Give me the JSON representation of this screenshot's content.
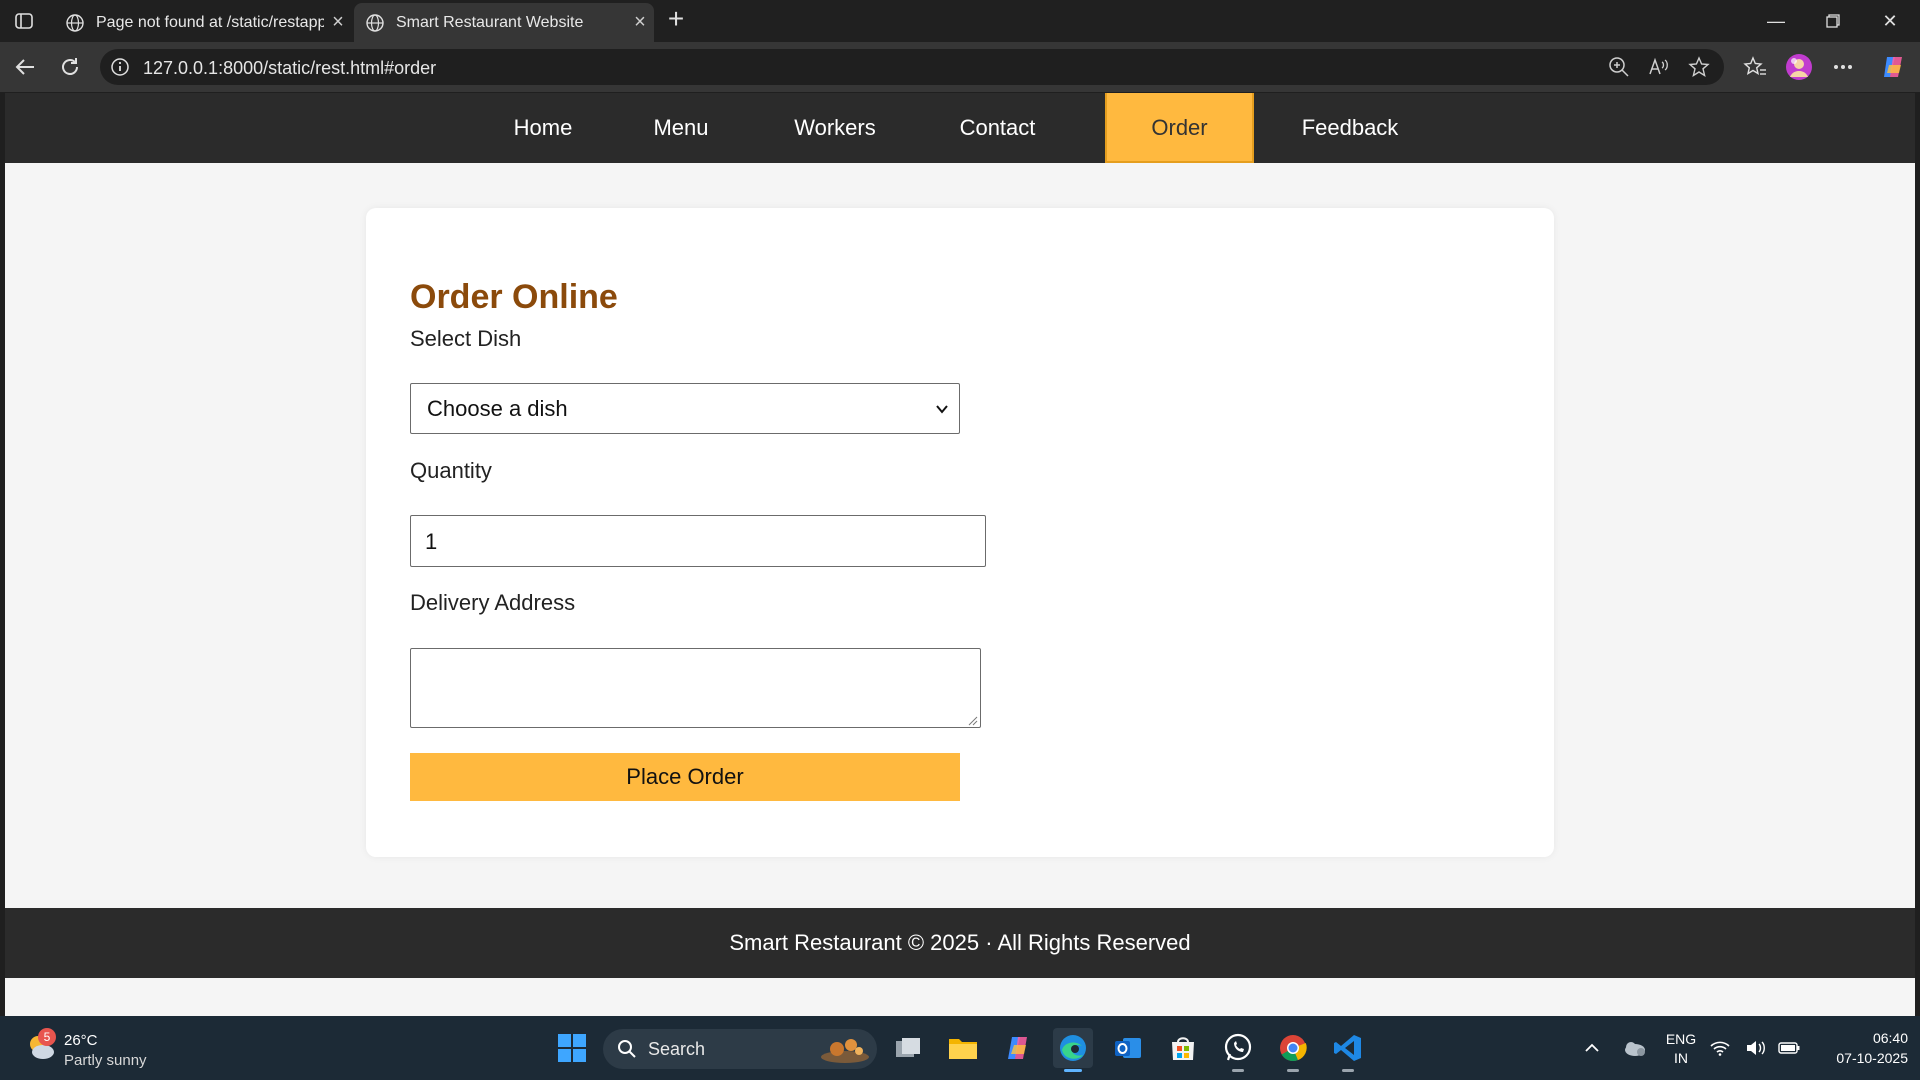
{
  "browser": {
    "tabs": [
      {
        "title": "Page not found at /static/restapp",
        "active": false
      },
      {
        "title": "Smart Restaurant Website",
        "active": true
      }
    ],
    "url": "127.0.0.1:8000/static/rest.html#order"
  },
  "site": {
    "nav": [
      "Home",
      "Menu",
      "Workers",
      "Contact",
      "Order",
      "Feedback"
    ],
    "active_nav": "Order",
    "accent_color": "#ffb93f",
    "heading_color": "#8b4a0b",
    "order": {
      "title": "Order Online",
      "dish_label": "Select Dish",
      "dish_selected": "Choose a dish",
      "quantity_label": "Quantity",
      "quantity_value": "1",
      "address_label": "Delivery Address",
      "address_value": "",
      "submit_label": "Place Order"
    },
    "footer": "Smart Restaurant © 2025 · All Rights Reserved"
  },
  "taskbar": {
    "weather": {
      "badge": "5",
      "temp": "26°C",
      "condition": "Partly sunny"
    },
    "search_label": "Search",
    "language": {
      "line1": "ENG",
      "line2": "IN"
    },
    "clock": {
      "time": "06:40",
      "date": "07-10-2025"
    },
    "apps": [
      "task-view-icon",
      "file-explorer-icon",
      "copilot-icon",
      "edge-icon",
      "outlook-icon",
      "microsoft-store-icon",
      "whatsapp-icon",
      "chrome-icon",
      "vscode-icon"
    ]
  }
}
